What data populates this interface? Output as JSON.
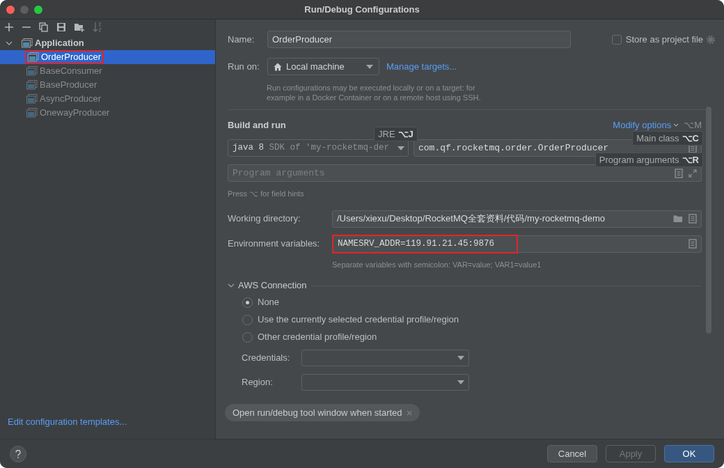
{
  "window": {
    "title": "Run/Debug Configurations"
  },
  "sidebar": {
    "tree": [
      {
        "label": "Application",
        "expanded": true,
        "selected": false,
        "children": [
          {
            "label": "OrderProducer",
            "selected": true,
            "highlighted": true
          },
          {
            "label": "BaseConsumer",
            "selected": false,
            "highlighted": false
          },
          {
            "label": "BaseProducer",
            "selected": false,
            "highlighted": false
          },
          {
            "label": "AsyncProducer",
            "selected": false,
            "highlighted": false
          },
          {
            "label": "OnewayProducer",
            "selected": false,
            "highlighted": false
          }
        ]
      }
    ],
    "footer_link": "Edit configuration templates..."
  },
  "name": {
    "label": "Name:",
    "value": "OrderProducer"
  },
  "store_as_project_file": {
    "label": "Store as project file",
    "checked": false
  },
  "run_on": {
    "label": "Run on:",
    "value": "Local machine",
    "link": "Manage targets...",
    "help": "Run configurations may be executed locally or on a target: for example in a Docker Container or on a remote host using SSH."
  },
  "build_and_run": {
    "title": "Build and run",
    "modify_options": "Modify options",
    "modify_shortcut": "⌥M",
    "jre": {
      "value": "java 8",
      "hint": "SDK of 'my-rocketmq-der"
    },
    "main_class": "com.qf.rocketmq.order.OrderProducer",
    "program_arguments": {
      "placeholder": "Program arguments"
    },
    "hint": "Press ⌥ for field hints"
  },
  "tooltips": [
    {
      "text": "JRE",
      "shortcut": "⌥J"
    },
    {
      "text": "Main class",
      "shortcut": "⌥C"
    },
    {
      "text": "Program arguments",
      "shortcut": "⌥R"
    }
  ],
  "working_directory": {
    "label": "Working directory:",
    "value": "/Users/xiexu/Desktop/RocketMQ全套资料/代码/my-rocketmq-demo"
  },
  "environment_variables": {
    "label": "Environment variables:",
    "value": "NAMESRV_ADDR=119.91.21.45:9876",
    "highlighted": true,
    "hint": "Separate variables with semicolon: VAR=value; VAR1=value1"
  },
  "aws_connection": {
    "title": "AWS Connection",
    "expanded": true,
    "options": [
      {
        "label": "None",
        "selected": true
      },
      {
        "label": "Use the currently selected credential profile/region",
        "selected": false
      },
      {
        "label": "Other credential profile/region",
        "selected": false
      }
    ],
    "credentials": {
      "label": "Credentials:"
    },
    "region": {
      "label": "Region:"
    }
  },
  "chip": {
    "label": "Open run/debug tool window when started"
  },
  "buttons": [
    {
      "label": "Cancel",
      "kind": "normal"
    },
    {
      "label": "Apply",
      "kind": "disabled"
    },
    {
      "label": "OK",
      "kind": "default"
    }
  ]
}
